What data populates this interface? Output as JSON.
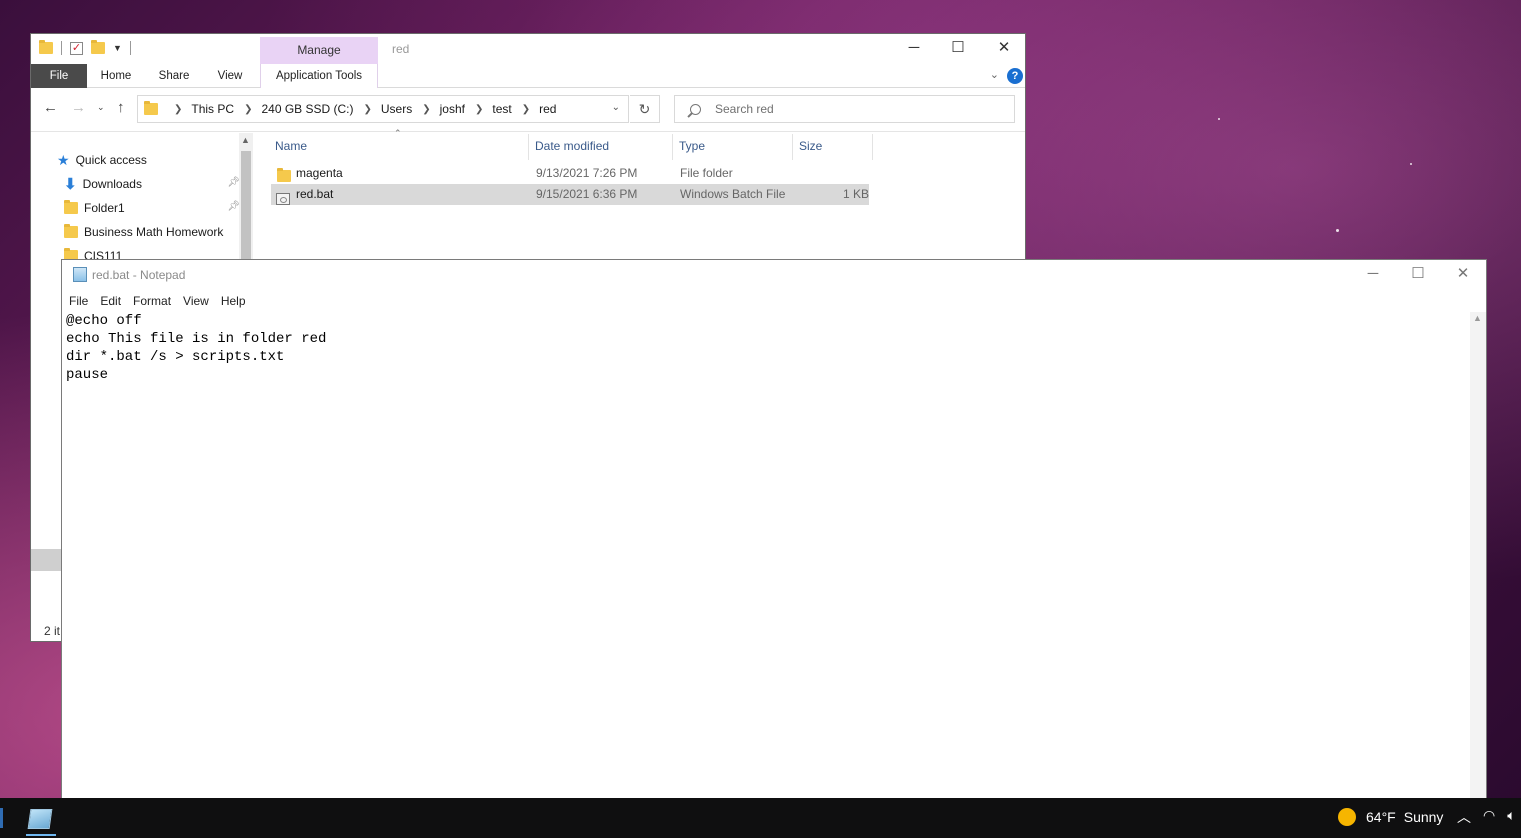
{
  "explorer": {
    "window_title": "red",
    "manage_tab": "Manage",
    "ribbon_tabs": [
      "File",
      "Home",
      "Share",
      "View",
      "Application Tools"
    ],
    "breadcrumb": [
      "This PC",
      "240 GB SSD (C:)",
      "Users",
      "joshf",
      "test",
      "red"
    ],
    "search_placeholder": "Search red",
    "nav_items": [
      {
        "label": "Quick access",
        "icon": "star-icon"
      },
      {
        "label": "Downloads",
        "icon": "download-icon",
        "pinned": true
      },
      {
        "label": "Folder1",
        "icon": "folder-icon",
        "pinned": true
      },
      {
        "label": "Business Math Homework",
        "icon": "folder-icon"
      },
      {
        "label": "CIS111",
        "icon": "folder-icon"
      }
    ],
    "columns": [
      "Name",
      "Date modified",
      "Type",
      "Size"
    ],
    "files": [
      {
        "name": "magenta",
        "date": "9/13/2021 7:26 PM",
        "type": "File folder",
        "size": "",
        "icon": "folder-icon",
        "selected": false
      },
      {
        "name": "red.bat",
        "date": "9/15/2021 6:36 PM",
        "type": "Windows Batch File",
        "size": "1 KB",
        "icon": "batch-file-icon",
        "selected": true
      }
    ],
    "status_text": "2 it"
  },
  "notepad": {
    "title": "red.bat - Notepad",
    "menu": [
      "File",
      "Edit",
      "Format",
      "View",
      "Help"
    ],
    "content": "@echo off\necho This file is in folder red\ndir *.bat /s > scripts.txt\npause"
  },
  "taskbar": {
    "weather_temp": "64°F",
    "weather_text": "Sunny",
    "weather_icon": "sun-icon"
  }
}
